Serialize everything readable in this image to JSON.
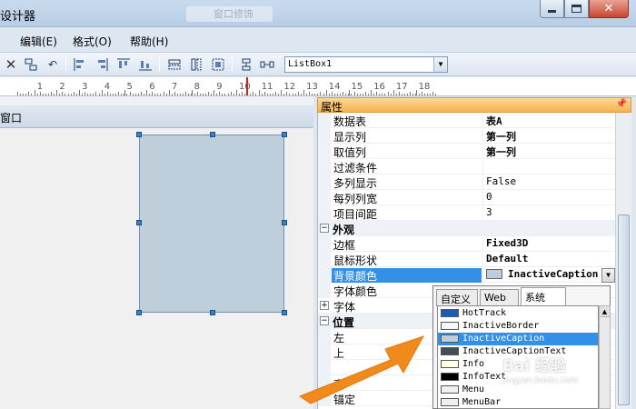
{
  "window": {
    "title": "设计器",
    "ghost_tab": "窗口修饰"
  },
  "menu": {
    "items": [
      "编辑(E)",
      "格式(O)",
      "帮助(H)"
    ]
  },
  "toolbar": {
    "combo_value": "ListBox1"
  },
  "ruler": {
    "numbers": [
      "1",
      "2",
      "3",
      "4",
      "5",
      "6",
      "7",
      "8",
      "9",
      "10",
      "11",
      "12",
      "13",
      "14",
      "15",
      "16",
      "17",
      "18"
    ],
    "marker_position": 10.2
  },
  "design": {
    "form_title": "窗口"
  },
  "properties": {
    "header": "属性",
    "rows": [
      {
        "type": "prop",
        "name": "数据表",
        "value": "表A",
        "bold": true
      },
      {
        "type": "prop",
        "name": "显示列",
        "value": "第一列",
        "bold": true
      },
      {
        "type": "prop",
        "name": "取值列",
        "value": "第一列",
        "bold": true
      },
      {
        "type": "prop",
        "name": "过滤条件",
        "value": ""
      },
      {
        "type": "prop",
        "name": "多列显示",
        "value": "False"
      },
      {
        "type": "prop",
        "name": "每列列宽",
        "value": "0"
      },
      {
        "type": "prop",
        "name": "项目间距",
        "value": "3"
      },
      {
        "type": "cat",
        "name": "外观",
        "toggle": "−"
      },
      {
        "type": "prop",
        "name": "边框",
        "value": "Fixed3D",
        "bold": true
      },
      {
        "type": "prop",
        "name": "鼠标形状",
        "value": "Default",
        "bold": true
      },
      {
        "type": "prop",
        "name": "背景颜色",
        "value": "InactiveCaption",
        "bold": true,
        "selected": true,
        "swatch": "#bfcddb"
      },
      {
        "type": "prop",
        "name": "字体颜色",
        "value": ""
      },
      {
        "type": "cat",
        "name": "字体",
        "toggle": "+",
        "plain": true
      },
      {
        "type": "cat",
        "name": "位置",
        "toggle": "−"
      },
      {
        "type": "prop",
        "name": "左",
        "value": ""
      },
      {
        "type": "prop",
        "name": "上",
        "value": ""
      },
      {
        "type": "prop",
        "name": "",
        "value": ""
      },
      {
        "type": "prop",
        "name": "高",
        "value": ""
      },
      {
        "type": "prop",
        "name": "锚定",
        "value": ""
      }
    ]
  },
  "color_popup": {
    "tabs": [
      "自定义",
      "Web",
      "系统"
    ],
    "active_tab": 2,
    "items": [
      {
        "name": "HotTrack",
        "color": "#1c5bb6"
      },
      {
        "name": "InactiveBorder",
        "color": "#f4f7fc"
      },
      {
        "name": "InactiveCaption",
        "color": "#bfcddb",
        "highlighted": true
      },
      {
        "name": "InactiveCaptionText",
        "color": "#434e54"
      },
      {
        "name": "Info",
        "color": "#ffffe1"
      },
      {
        "name": "InfoText",
        "color": "#000000"
      },
      {
        "name": "Menu",
        "color": "#f0f0f0"
      },
      {
        "name": "MenuBar",
        "color": "#f0f0f0"
      }
    ]
  },
  "watermark": {
    "text": "Bai 经验",
    "sub": "jingyan.baidu.com"
  },
  "colors": {
    "accent_orange": "#f08a1c",
    "selection_blue": "#3390e8"
  }
}
